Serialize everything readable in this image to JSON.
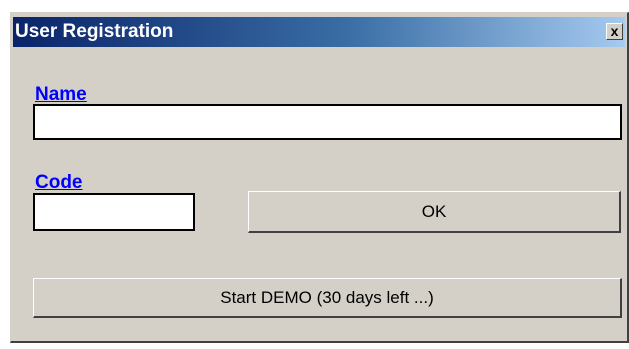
{
  "window": {
    "title": "User Registration",
    "close_glyph": "x",
    "close_icon": "close-icon"
  },
  "form": {
    "name_label": "Name",
    "name_value": "",
    "code_label": "Code",
    "code_value": ""
  },
  "buttons": {
    "ok_label": "OK",
    "demo_label": "Start DEMO (30 days left ...)"
  },
  "colors": {
    "title_bar_start": "#0a246a",
    "title_bar_end": "#a6caf0",
    "label_color": "#0000ff",
    "dialog_bg": "#d4d0c8"
  }
}
